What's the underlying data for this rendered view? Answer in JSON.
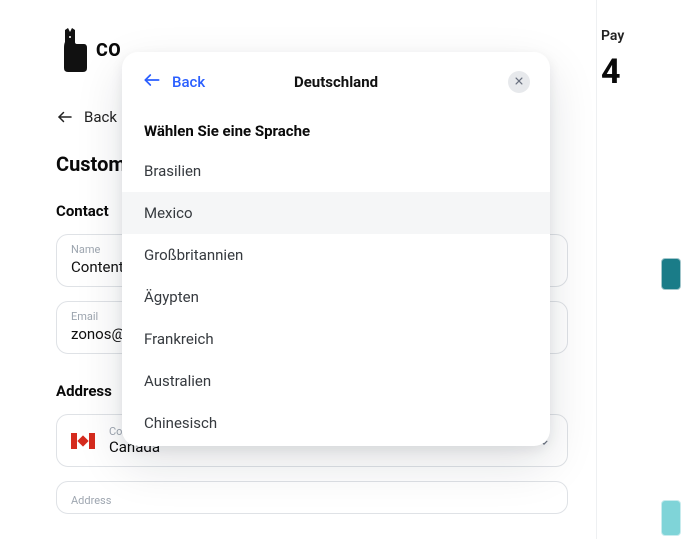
{
  "brand": {
    "name": "COTOPAXI",
    "visible": "CO"
  },
  "nav": {
    "back_label": "Back"
  },
  "page": {
    "title": "Customer info"
  },
  "contact": {
    "section_label": "Contact",
    "name_label": "Name",
    "name_value": "Content",
    "email_label": "Email",
    "email_value": "zonos@"
  },
  "address": {
    "section_label": "Address",
    "country_label": "Country",
    "country_value": "Canada",
    "address_label": "Address"
  },
  "summary": {
    "pay_label": "Pay",
    "amount_visible": "4"
  },
  "modal": {
    "back_label": "Back",
    "title": "Deutschland",
    "subtitle": "Wählen Sie eine Sprache",
    "options": [
      {
        "label": "Brasilien",
        "active": false
      },
      {
        "label": "Mexico",
        "active": true
      },
      {
        "label": "Großbritannien",
        "active": false
      },
      {
        "label": "Ägypten",
        "active": false
      },
      {
        "label": "Frankreich",
        "active": false
      },
      {
        "label": "Australien",
        "active": false
      },
      {
        "label": "Chinesisch",
        "active": false
      }
    ]
  }
}
